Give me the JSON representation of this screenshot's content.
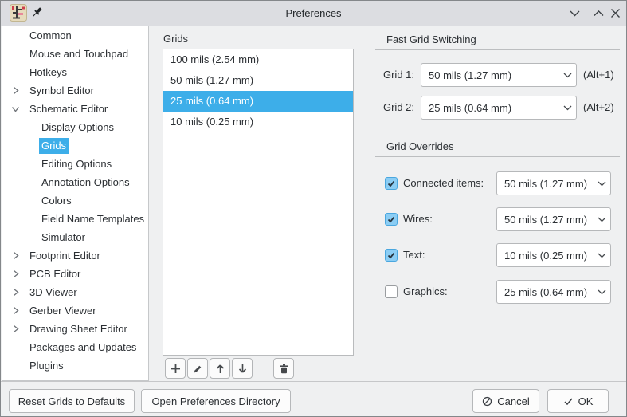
{
  "window": {
    "title": "Preferences"
  },
  "icons": {
    "titlebar": [
      "app-icon",
      "pin-icon",
      "chevron-down-minimize",
      "chevron-up-maximize",
      "close-x"
    ],
    "tree": [
      "chevron-right-collapsed",
      "chevron-down-expanded"
    ],
    "list_toolbar": [
      "add-plus",
      "edit-pencil",
      "move-up-arrow",
      "move-down-arrow",
      "delete-trash"
    ],
    "dropdown": "chevron-down",
    "footer": [
      "cancel-slash-circle",
      "ok-checkmark"
    ]
  },
  "colors": {
    "accent_selection": "#3daee9",
    "titlebar_bg": "#dcdde1",
    "dialog_bg": "#eff0f1",
    "panel_bg": "#ffffff",
    "checkbox_checked_bg": "#8bcdf4"
  },
  "sidebar": {
    "items": [
      {
        "label": "Common",
        "depth": 1,
        "expand": "none",
        "selected": false
      },
      {
        "label": "Mouse and Touchpad",
        "depth": 1,
        "expand": "none",
        "selected": false
      },
      {
        "label": "Hotkeys",
        "depth": 1,
        "expand": "none",
        "selected": false
      },
      {
        "label": "Symbol Editor",
        "depth": 1,
        "expand": "collapsed",
        "selected": false
      },
      {
        "label": "Schematic Editor",
        "depth": 1,
        "expand": "expanded",
        "selected": false
      },
      {
        "label": "Display Options",
        "depth": 2,
        "expand": "none",
        "selected": false
      },
      {
        "label": "Grids",
        "depth": 2,
        "expand": "none",
        "selected": true
      },
      {
        "label": "Editing Options",
        "depth": 2,
        "expand": "none",
        "selected": false
      },
      {
        "label": "Annotation Options",
        "depth": 2,
        "expand": "none",
        "selected": false
      },
      {
        "label": "Colors",
        "depth": 2,
        "expand": "none",
        "selected": false
      },
      {
        "label": "Field Name Templates",
        "depth": 2,
        "expand": "none",
        "selected": false
      },
      {
        "label": "Simulator",
        "depth": 2,
        "expand": "none",
        "selected": false
      },
      {
        "label": "Footprint Editor",
        "depth": 1,
        "expand": "collapsed",
        "selected": false
      },
      {
        "label": "PCB Editor",
        "depth": 1,
        "expand": "collapsed",
        "selected": false
      },
      {
        "label": "3D Viewer",
        "depth": 1,
        "expand": "collapsed",
        "selected": false
      },
      {
        "label": "Gerber Viewer",
        "depth": 1,
        "expand": "collapsed",
        "selected": false
      },
      {
        "label": "Drawing Sheet Editor",
        "depth": 1,
        "expand": "collapsed",
        "selected": false
      },
      {
        "label": "Packages and Updates",
        "depth": 1,
        "expand": "none",
        "selected": false
      },
      {
        "label": "Plugins",
        "depth": 1,
        "expand": "none",
        "selected": false
      }
    ]
  },
  "grids_panel": {
    "label": "Grids",
    "items": [
      "100 mils (2.54 mm)",
      "50 mils (1.27 mm)",
      "25 mils (0.64 mm)",
      "10 mils (0.25 mm)"
    ],
    "selected_index": 2
  },
  "fast_grid_switching": {
    "title": "Fast Grid Switching",
    "rows": [
      {
        "label": "Grid 1:",
        "value": "50 mils (1.27 mm)",
        "shortcut": "(Alt+1)"
      },
      {
        "label": "Grid 2:",
        "value": "25 mils (0.64 mm)",
        "shortcut": "(Alt+2)"
      }
    ]
  },
  "grid_overrides": {
    "title": "Grid Overrides",
    "rows": [
      {
        "label": "Connected items:",
        "checked": true,
        "value": "50 mils (1.27 mm)"
      },
      {
        "label": "Wires:",
        "checked": true,
        "value": "50 mils (1.27 mm)"
      },
      {
        "label": "Text:",
        "checked": true,
        "value": "10 mils (0.25 mm)"
      },
      {
        "label": "Graphics:",
        "checked": false,
        "value": "25 mils (0.64 mm)"
      }
    ]
  },
  "footer": {
    "reset_label": "Reset Grids to Defaults",
    "open_prefs_label": "Open Preferences Directory",
    "cancel_label": "Cancel",
    "ok_label": "OK"
  }
}
